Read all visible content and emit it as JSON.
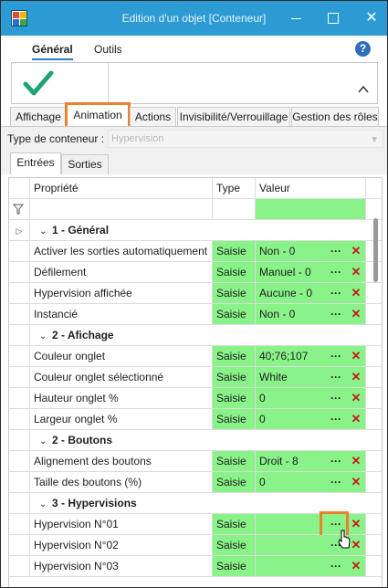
{
  "window": {
    "title": "Edition d'un objet [Conteneur]",
    "close_glyph": "✕"
  },
  "ribbon": {
    "tabs": [
      "Général",
      "Outils"
    ],
    "help_label": "?"
  },
  "main_tabs": [
    "Affichage",
    "Animation",
    "Actions",
    "Invisibilité/Verrouillage",
    "Gestion des rôles"
  ],
  "container_type": {
    "label": "Type de conteneur :",
    "value": "Hypervision"
  },
  "sub_tabs": [
    "Entrées",
    "Sorties"
  ],
  "grid": {
    "headers": {
      "property": "Propriété",
      "type": "Type",
      "value": "Valeur"
    },
    "groups": [
      {
        "label": "1 - Général",
        "rows": [
          {
            "property": "Activer les sorties automatiquement",
            "type": "Saisie",
            "value": "Non - 0"
          },
          {
            "property": "Défilement",
            "type": "Saisie",
            "value": "Manuel - 0"
          },
          {
            "property": "Hypervision affichée",
            "type": "Saisie",
            "value": "Aucune - 0"
          },
          {
            "property": "Instancié",
            "type": "Saisie",
            "value": "Non - 0"
          }
        ]
      },
      {
        "label": "2 - Afichage",
        "rows": [
          {
            "property": "Couleur onglet",
            "type": "Saisie",
            "value": "40;76;107"
          },
          {
            "property": "Couleur onglet sélectionné",
            "type": "Saisie",
            "value": "White"
          },
          {
            "property": "Hauteur onglet %",
            "type": "Saisie",
            "value": "0"
          },
          {
            "property": "Largeur onglet %",
            "type": "Saisie",
            "value": "0"
          }
        ]
      },
      {
        "label": "2 - Boutons",
        "rows": [
          {
            "property": "Alignement des boutons",
            "type": "Saisie",
            "value": "Droit - 8"
          },
          {
            "property": "Taille des boutons (%)",
            "type": "Saisie",
            "value": "0"
          }
        ]
      },
      {
        "label": "3 - Hypervisions",
        "rows": [
          {
            "property": "Hypervision N°01",
            "type": "Saisie",
            "value": ""
          },
          {
            "property": "Hypervision N°02",
            "type": "Saisie",
            "value": ""
          },
          {
            "property": "Hypervision N°03",
            "type": "Saisie",
            "value": ""
          }
        ]
      }
    ],
    "dots_label": "···",
    "delete_label": "✕",
    "expand_glyph": "▷",
    "group_glyph": "⌄"
  },
  "colors": {
    "titlebar": "#2d9bd3",
    "accent_highlight": "#f07f2c",
    "input_green": "#89f389",
    "delete_red": "#c21c1c",
    "confirm_check": "#1fa37a"
  }
}
